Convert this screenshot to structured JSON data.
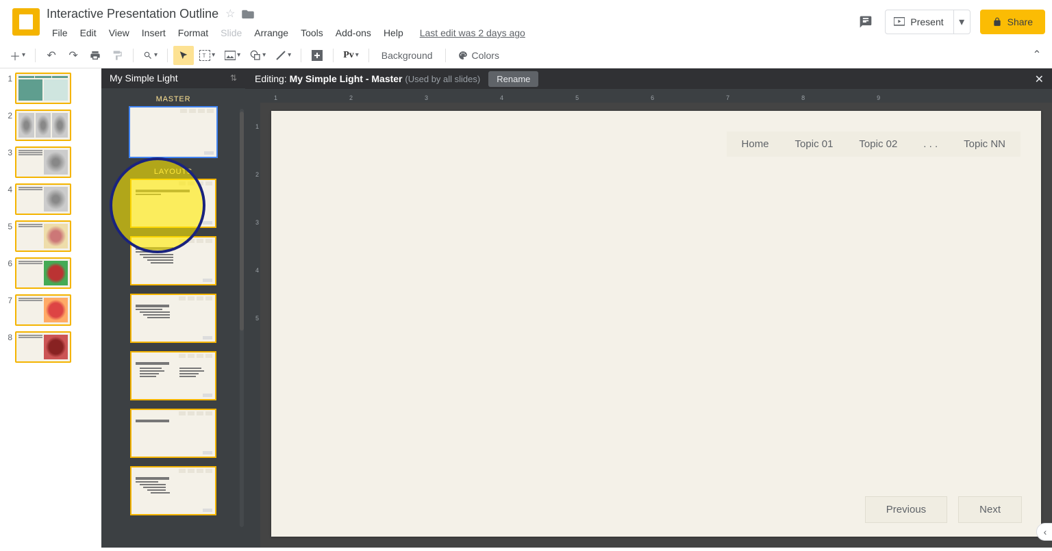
{
  "header": {
    "doc_title": "Interactive Presentation Outline",
    "menus": [
      "File",
      "Edit",
      "View",
      "Insert",
      "Format",
      "Slide",
      "Arrange",
      "Tools",
      "Add-ons",
      "Help"
    ],
    "disabled_menu_index": 5,
    "last_edit": "Last edit was 2 days ago",
    "present_label": "Present",
    "share_label": "Share"
  },
  "toolbar": {
    "background_label": "Background",
    "colors_label": "Colors",
    "pv_label": "Pv"
  },
  "filmstrip": {
    "count": 8
  },
  "master_panel": {
    "theme_name": "My Simple Light",
    "master_label": "MASTER",
    "layouts_label": "LAYOUTS"
  },
  "canvas": {
    "editing_prefix": "Editing:",
    "editing_title": "My Simple Light - Master",
    "used_by": "(Used by all slides)",
    "rename_label": "Rename",
    "ruler_h": [
      "1",
      "2",
      "3",
      "4",
      "5",
      "6",
      "7",
      "8",
      "9"
    ],
    "ruler_v": [
      "1",
      "2",
      "3",
      "4",
      "5"
    ],
    "nav_items": [
      "Home",
      "Topic 01",
      "Topic 02",
      ". . .",
      "Topic NN"
    ],
    "prev_label": "Previous",
    "next_label": "Next"
  }
}
